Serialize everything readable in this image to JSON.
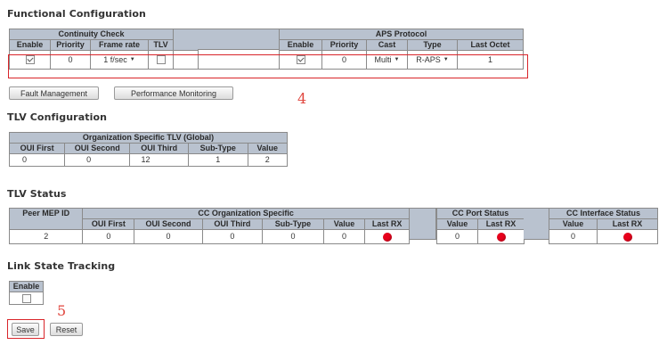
{
  "functional": {
    "heading": "Functional Configuration",
    "cc_header": "Continuity Check",
    "aps_header": "APS Protocol",
    "cc_columns": [
      "Enable",
      "Priority",
      "Frame rate",
      "TLV"
    ],
    "aps_columns": [
      "Enable",
      "Priority",
      "Cast",
      "Type",
      "Last Octet"
    ],
    "row": {
      "cc_enable": true,
      "cc_priority": "0",
      "frame_rate": "1 f/sec",
      "tlv": false,
      "aps_enable": true,
      "aps_priority": "0",
      "cast": "Multi",
      "type": "R-APS",
      "last_octet": "1"
    },
    "annotation": "4"
  },
  "buttons": {
    "fault_management": "Fault Management",
    "performance_monitoring": "Performance Monitoring",
    "save": "Save",
    "reset": "Reset"
  },
  "tlv_config": {
    "heading": "TLV Configuration",
    "group_header": "Organization Specific TLV (Global)",
    "columns": [
      "OUI First",
      "OUI Second",
      "OUI Third",
      "Sub-Type",
      "Value"
    ],
    "values": [
      "0",
      "0",
      "12",
      "1",
      "2"
    ]
  },
  "tlv_status": {
    "heading": "TLV Status",
    "peer_header": "Peer MEP ID",
    "org_header": "CC Organization Specific",
    "port_header": "CC Port Status",
    "iface_header": "CC Interface Status",
    "org_columns": [
      "OUI First",
      "OUI Second",
      "OUI Third",
      "Sub-Type",
      "Value",
      "Last RX"
    ],
    "port_columns": [
      "Value",
      "Last RX"
    ],
    "iface_columns": [
      "Value",
      "Last RX"
    ],
    "row": {
      "peer_mep_id": "2",
      "oui_first": "0",
      "oui_second": "0",
      "oui_third": "0",
      "sub_type": "0",
      "value": "0",
      "port_value": "0",
      "iface_value": "0"
    },
    "led_color": "#e8001c"
  },
  "link_state": {
    "heading": "Link State Tracking",
    "enable_label": "Enable",
    "enabled": false,
    "annotation": "5"
  },
  "colors": {
    "header_bg": "#b9c2cf",
    "highlight": "#d9252a"
  }
}
